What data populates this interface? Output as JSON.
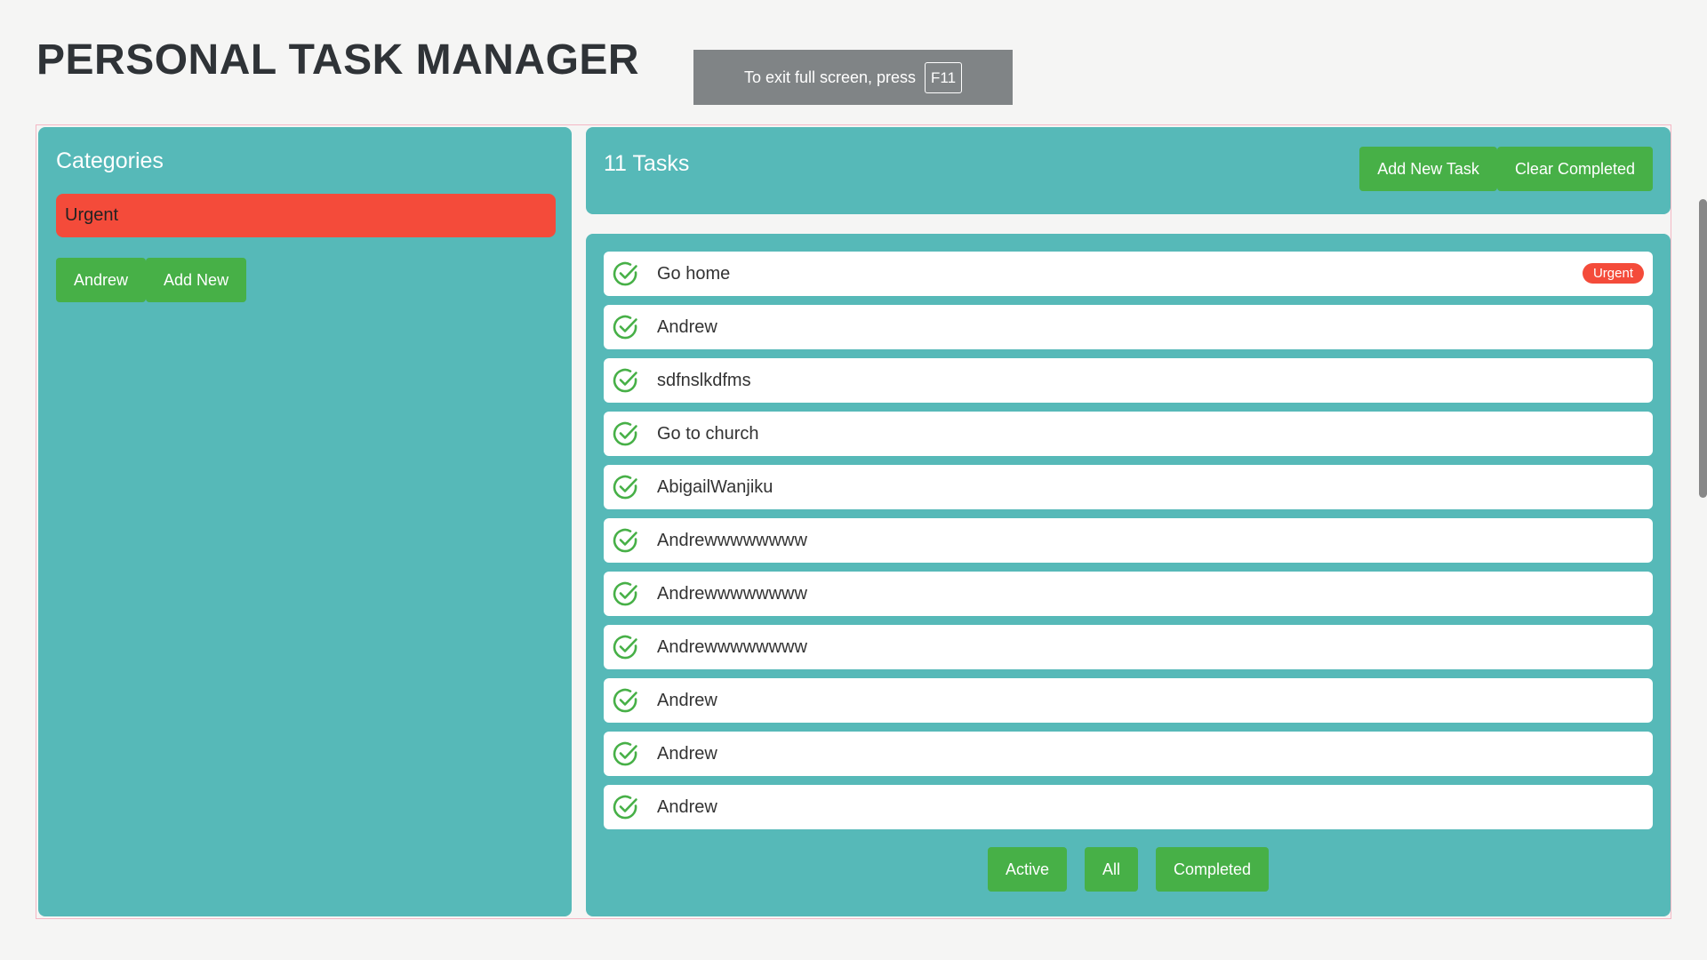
{
  "app": {
    "title": "PERSONAL TASK MANAGER"
  },
  "fullscreen_notice": {
    "text": "To exit full screen, press",
    "key": "F11"
  },
  "categories": {
    "title": "Categories",
    "items": [
      {
        "label": "Urgent",
        "color": "#f44b3a"
      }
    ],
    "buttons": [
      {
        "label": "Andrew"
      },
      {
        "label": "Add New"
      }
    ]
  },
  "tasks": {
    "count_label": "11 Tasks",
    "header_buttons": {
      "add_label": "Add New Task",
      "clear_label": "Clear Completed"
    },
    "items": [
      {
        "text": "Go home",
        "badge": "Urgent",
        "icon": "check-circle-icon"
      },
      {
        "text": "Andrew",
        "icon": "check-circle-icon"
      },
      {
        "text": "sdfnslkdfms",
        "icon": "check-circle-icon"
      },
      {
        "text": "Go to church",
        "icon": "check-circle-icon"
      },
      {
        "text": "AbigailWanjiku",
        "icon": "check-circle-icon"
      },
      {
        "text": "Andrewwwwwwww",
        "icon": "check-circle-icon"
      },
      {
        "text": "Andrewwwwwwww",
        "icon": "check-circle-icon"
      },
      {
        "text": "Andrewwwwwwww",
        "icon": "check-circle-icon"
      },
      {
        "text": "Andrew",
        "icon": "check-circle-icon"
      },
      {
        "text": "Andrew",
        "icon": "check-circle-icon"
      },
      {
        "text": "Andrew",
        "icon": "check-circle-icon"
      }
    ],
    "filters": {
      "active_label": "Active",
      "all_label": "All",
      "completed_label": "Completed"
    }
  },
  "colors": {
    "panel": "#56b9b8",
    "button": "#47b047",
    "urgent": "#f44b3a",
    "background": "#f5f5f4"
  }
}
